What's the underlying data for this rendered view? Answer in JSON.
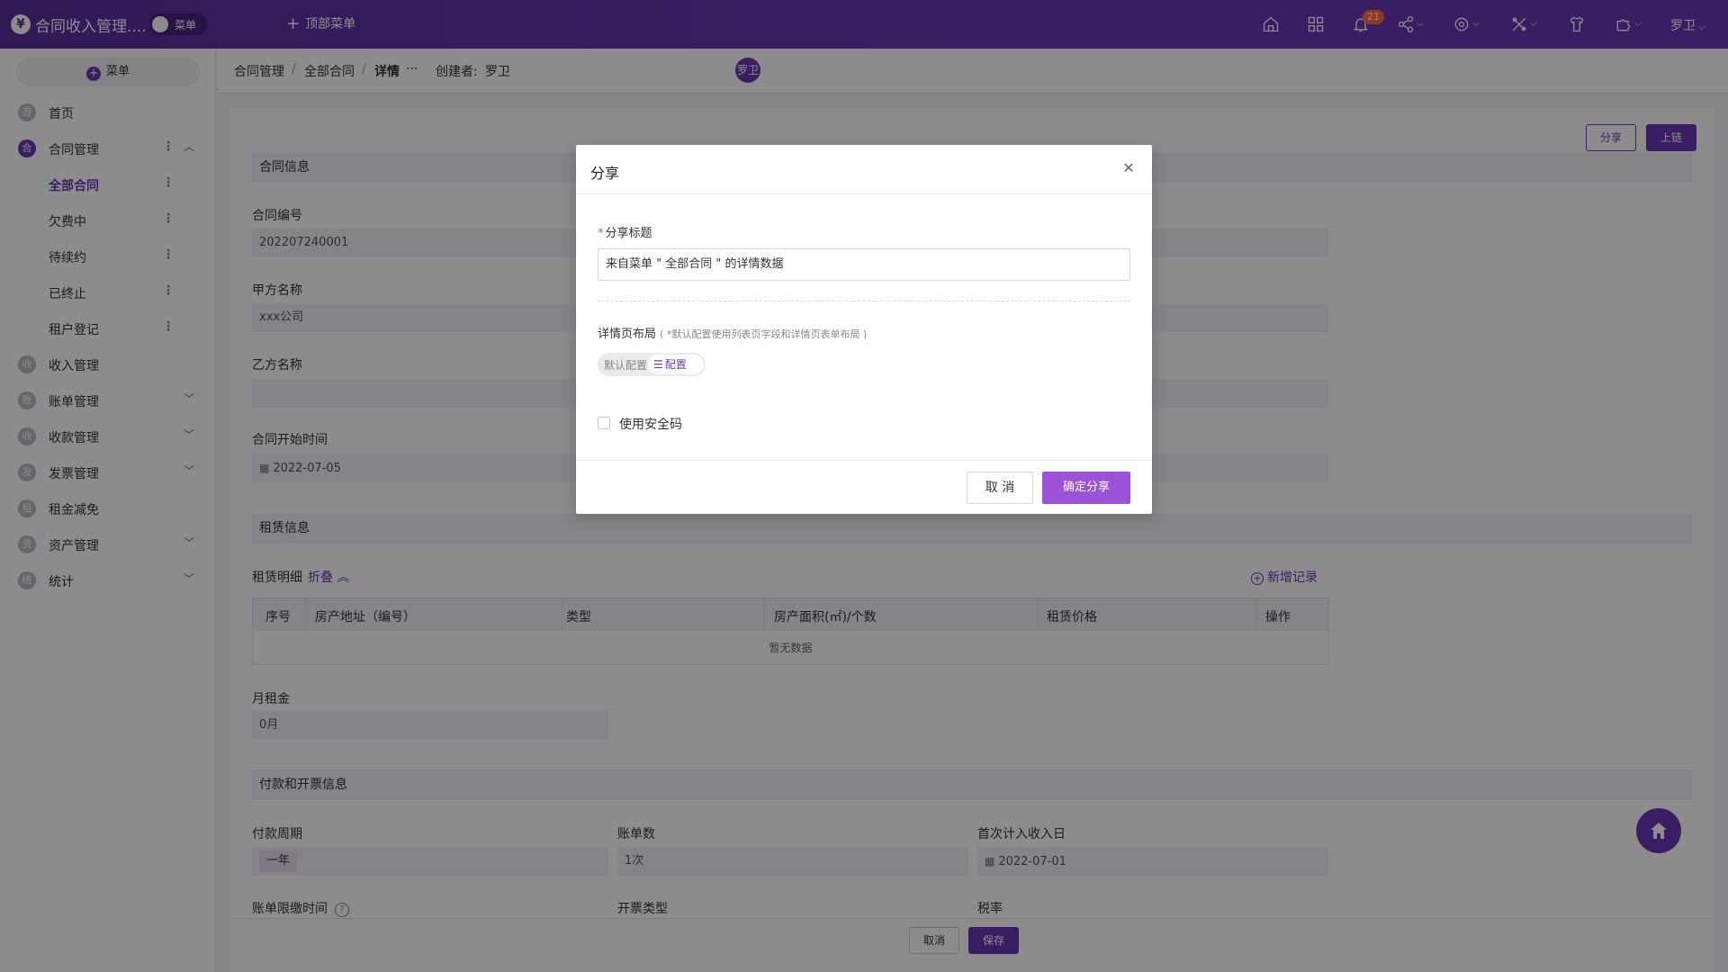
{
  "app": {
    "logo_glyph": "¥",
    "title": "合同收入管理....",
    "menu_toggle_label": "菜单",
    "top_menu_label": "顶部菜单",
    "user_name": "罗卫",
    "notification_count": "21"
  },
  "topbar_icons": [
    "home-icon",
    "apps-icon",
    "bell-icon",
    "share-icon",
    "settings-icon",
    "tools-icon",
    "shirt-icon",
    "puzzle-icon"
  ],
  "sidebar": {
    "menu_button": "菜单",
    "items": [
      {
        "icon_text": "首",
        "label": "首页"
      },
      {
        "icon_text": "合",
        "label": "合同管理"
      },
      {
        "label": "全部合同"
      },
      {
        "label": "欠费中"
      },
      {
        "label": "待续约"
      },
      {
        "label": "已终止"
      },
      {
        "label": "租户登记"
      },
      {
        "icon_text": "收",
        "label": "收入管理"
      },
      {
        "icon_text": "账",
        "label": "账单管理"
      },
      {
        "icon_text": "收",
        "label": "收款管理"
      },
      {
        "icon_text": "发",
        "label": "发票管理"
      },
      {
        "icon_text": "租",
        "label": "租金减免"
      },
      {
        "icon_text": "资",
        "label": "资产管理"
      },
      {
        "icon_text": "统",
        "label": "统计"
      }
    ]
  },
  "breadcrumb": {
    "items": [
      "合同管理",
      "全部合同",
      "详情"
    ],
    "separator": "/",
    "more": "···",
    "creator_label": "创建者:",
    "creator_name": "罗卫",
    "creator_avatar": "罗卫"
  },
  "actions": {
    "share": "分享",
    "chain": "上链"
  },
  "contract_info": {
    "section_title": "合同信息",
    "contract_no_label": "合同编号",
    "contract_no": "202207240001",
    "party_a_label": "甲方名称",
    "party_a": "xxx公司",
    "party_b_label": "乙方名称",
    "party_b": "",
    "start_label": "合同开始时间",
    "start_date": "2022-07-05"
  },
  "lease_info": {
    "section_title": "租赁信息",
    "detail_label": "租赁明细",
    "collapse": "折叠",
    "add_record": "新增记录",
    "columns": [
      "序号",
      "房产地址（编号）",
      "类型",
      "房产面积(㎡)/个数",
      "租赁价格",
      "操作"
    ],
    "empty_text": "暂无数据",
    "monthly_rent_label": "月租金",
    "monthly_rent": "0月"
  },
  "payment_info": {
    "section_title": "付款和开票信息",
    "cycle_label": "付款周期",
    "cycle": "一年",
    "bill_count_label": "账单数",
    "bill_count": "1次",
    "first_income_label": "首次计入收入日",
    "first_income_date": "2022-07-01",
    "deadline_label": "账单限缴时间",
    "invoice_type_label": "开票类型",
    "tax_rate_label": "税率"
  },
  "footer": {
    "cancel": "取消",
    "save": "保存"
  },
  "modal": {
    "title": "分享",
    "share_title_label": "分享标题",
    "share_title_value": "来自菜单 \" 全部合同 \" 的详情数据",
    "layout_label": "详情页布局",
    "layout_hint": "( *默认配置使用列表页字段和详情页表单布局 )",
    "layout_default": "默认配置",
    "layout_config": "配置",
    "security_label": "使用安全码",
    "cancel": "取 消",
    "confirm": "确定分享"
  }
}
